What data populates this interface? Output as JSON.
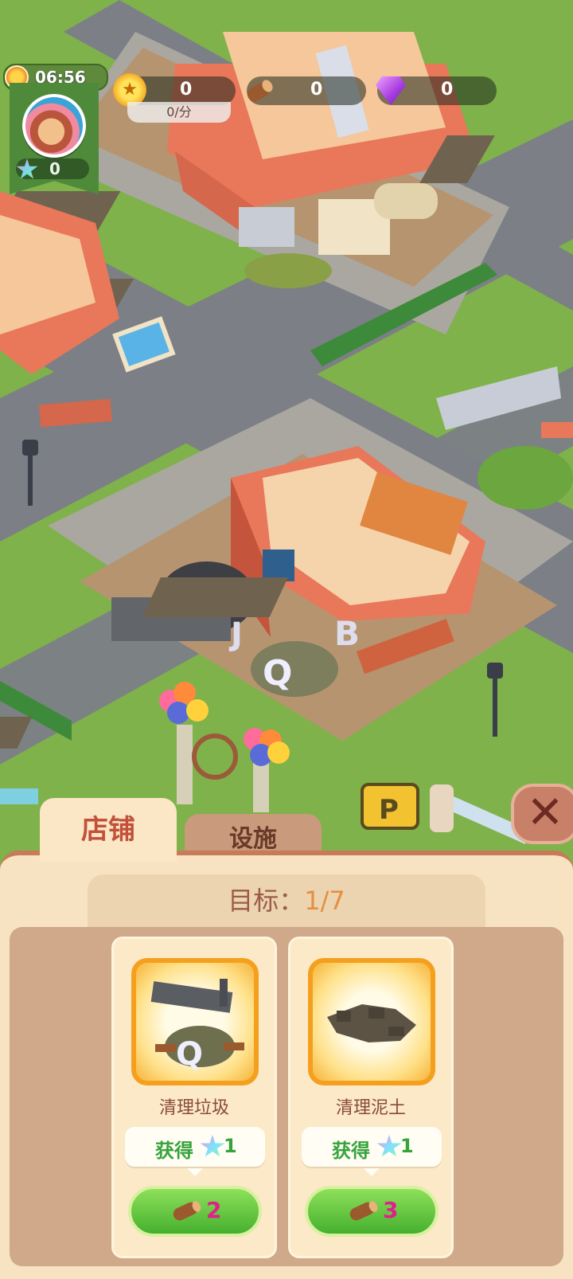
{
  "hud": {
    "time": "06:56",
    "stars": "0",
    "coins": "0",
    "coin_rate": "0/分",
    "wood": "0",
    "gems": "0"
  },
  "tabs": {
    "store": "店铺",
    "facilities": "设施"
  },
  "panel": {
    "goal_label": "目标：",
    "goal_progress": "1/7",
    "cards": [
      {
        "title": "清理垃圾",
        "reward_label": "获得",
        "reward_amount": "1",
        "cost": "2",
        "icon": "trash-pile-icon"
      },
      {
        "title": "清理泥土",
        "reward_label": "获得",
        "reward_amount": "1",
        "cost": "3",
        "icon": "dirt-pile-icon"
      }
    ]
  },
  "colors": {
    "grass": "#7fb24a",
    "road": "#777a82",
    "accent_orange": "#e58f40",
    "button_green": "#45b02e",
    "panel_bg": "#f7e3c2"
  }
}
